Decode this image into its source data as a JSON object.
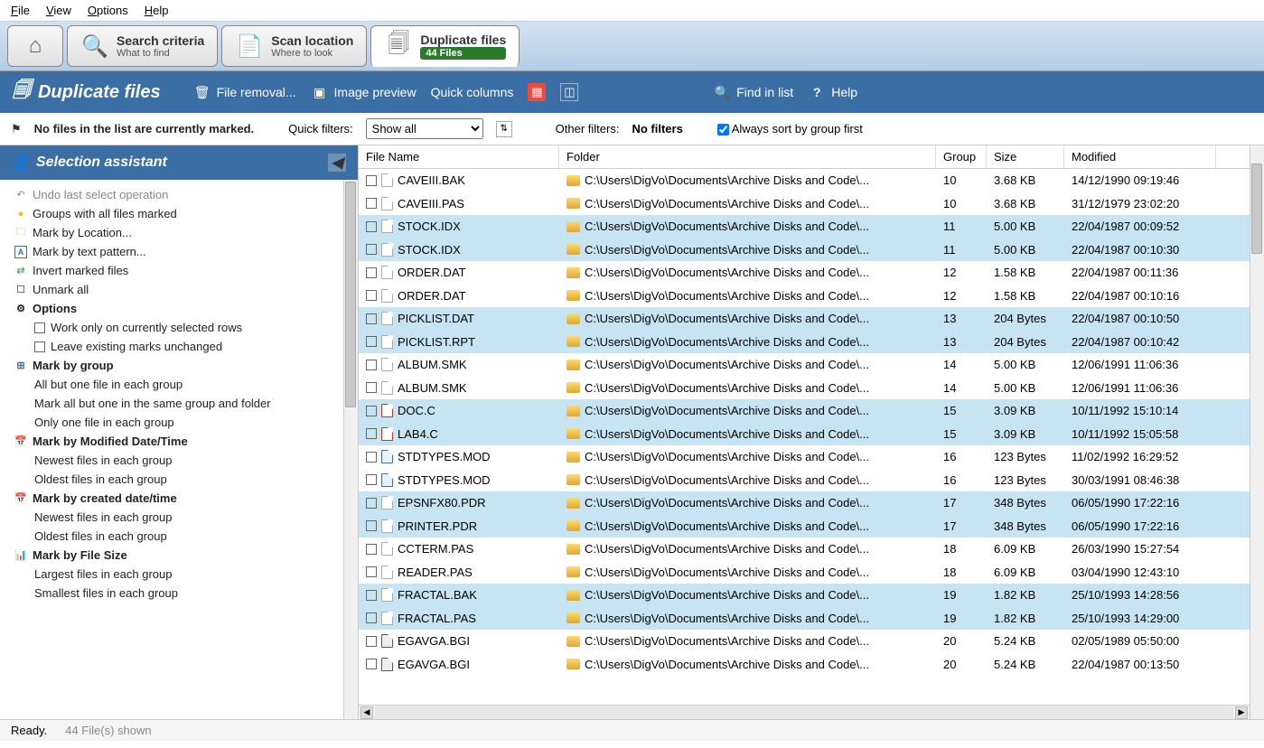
{
  "menu": {
    "file": "File",
    "view": "View",
    "options": "Options",
    "help": "Help"
  },
  "tabs": {
    "home": {
      "icon": "home"
    },
    "criteria": {
      "title": "Search criteria",
      "sub": "What to find"
    },
    "location": {
      "title": "Scan location",
      "sub": "Where to look"
    },
    "duplicates": {
      "title": "Duplicate files",
      "sub": "44 Files"
    }
  },
  "actionbar": {
    "title": "Duplicate files",
    "removal": "File removal...",
    "preview": "Image preview",
    "quickcols": "Quick columns",
    "findlist": "Find in list",
    "help": "Help"
  },
  "filterbar": {
    "marked_info": "No files in the list are currently marked.",
    "quick_label": "Quick filters:",
    "quick_value": "Show all",
    "other_label": "Other filters:",
    "other_value": "No filters",
    "always_sort": "Always sort by group first"
  },
  "sidebar": {
    "title": "Selection assistant",
    "undo": "Undo last select operation",
    "groups_marked": "Groups with all files marked",
    "mark_location": "Mark by Location...",
    "mark_text": "Mark by text pattern...",
    "invert": "Invert marked files",
    "unmark": "Unmark all",
    "options": "Options",
    "opt_work": "Work only on currently selected rows",
    "opt_leave": "Leave existing marks unchanged",
    "mark_group": "Mark by group",
    "mg_allbutone": "All but one file in each group",
    "mg_samegroup": "Mark all but one in the same group and folder",
    "mg_onlyone": "Only one file in each group",
    "mark_modified": "Mark by Modified Date/Time",
    "mm_newest": "Newest files in each group",
    "mm_oldest": "Oldest files in each group",
    "mark_created": "Mark by created date/time",
    "mc_newest": "Newest files in each group",
    "mc_oldest": "Oldest files in each group",
    "mark_size": "Mark by File Size",
    "ms_largest": "Largest files in each group",
    "ms_smallest": "Smallest files in each group"
  },
  "columns": {
    "name": "File Name",
    "folder": "Folder",
    "group": "Group",
    "size": "Size",
    "mod": "Modified"
  },
  "folder_path": "C:\\Users\\DigVo\\Documents\\Archive Disks and Code\\...",
  "files": [
    {
      "name": "CAVEIII.BAK",
      "group": "10",
      "size": "3.68 KB",
      "mod": "14/12/1990 09:19:46",
      "icon": "file",
      "alt": false
    },
    {
      "name": "CAVEIII.PAS",
      "group": "10",
      "size": "3.68 KB",
      "mod": "31/12/1979 23:02:20",
      "icon": "file",
      "alt": false
    },
    {
      "name": "STOCK.IDX",
      "group": "11",
      "size": "5.00 KB",
      "mod": "22/04/1987 00:09:52",
      "icon": "file",
      "alt": true
    },
    {
      "name": "STOCK.IDX",
      "group": "11",
      "size": "5.00 KB",
      "mod": "22/04/1987 00:10:30",
      "icon": "file",
      "alt": true
    },
    {
      "name": "ORDER.DAT",
      "group": "12",
      "size": "1.58 KB",
      "mod": "22/04/1987 00:11:36",
      "icon": "file",
      "alt": false
    },
    {
      "name": "ORDER.DAT",
      "group": "12",
      "size": "1.58 KB",
      "mod": "22/04/1987 00:10:16",
      "icon": "file",
      "alt": false
    },
    {
      "name": "PICKLIST.DAT",
      "group": "13",
      "size": "204 Bytes",
      "mod": "22/04/1987 00:10:50",
      "icon": "file",
      "alt": true
    },
    {
      "name": "PICKLIST.RPT",
      "group": "13",
      "size": "204 Bytes",
      "mod": "22/04/1987 00:10:42",
      "icon": "file",
      "alt": true
    },
    {
      "name": "ALBUM.SMK",
      "group": "14",
      "size": "5.00 KB",
      "mod": "12/06/1991 11:06:36",
      "icon": "file",
      "alt": false
    },
    {
      "name": "ALBUM.SMK",
      "group": "14",
      "size": "5.00 KB",
      "mod": "12/06/1991 11:06:36",
      "icon": "file",
      "alt": false
    },
    {
      "name": "DOC.C",
      "group": "15",
      "size": "3.09 KB",
      "mod": "10/11/1992 15:10:14",
      "icon": "c",
      "alt": true
    },
    {
      "name": "LAB4.C",
      "group": "15",
      "size": "3.09 KB",
      "mod": "10/11/1992 15:05:58",
      "icon": "c",
      "alt": true
    },
    {
      "name": "STDTYPES.MOD",
      "group": "16",
      "size": "123 Bytes",
      "mod": "11/02/1992 16:29:52",
      "icon": "mod",
      "alt": false
    },
    {
      "name": "STDTYPES.MOD",
      "group": "16",
      "size": "123 Bytes",
      "mod": "30/03/1991 08:46:38",
      "icon": "mod",
      "alt": false
    },
    {
      "name": "EPSNFX80.PDR",
      "group": "17",
      "size": "348 Bytes",
      "mod": "06/05/1990 17:22:16",
      "icon": "file",
      "alt": true
    },
    {
      "name": "PRINTER.PDR",
      "group": "17",
      "size": "348 Bytes",
      "mod": "06/05/1990 17:22:16",
      "icon": "file",
      "alt": true
    },
    {
      "name": "CCTERM.PAS",
      "group": "18",
      "size": "6.09 KB",
      "mod": "26/03/1990 15:27:54",
      "icon": "file",
      "alt": false
    },
    {
      "name": "READER.PAS",
      "group": "18",
      "size": "6.09 KB",
      "mod": "03/04/1990 12:43:10",
      "icon": "file",
      "alt": false
    },
    {
      "name": "FRACTAL.BAK",
      "group": "19",
      "size": "1.82 KB",
      "mod": "25/10/1993 14:28:56",
      "icon": "file",
      "alt": true
    },
    {
      "name": "FRACTAL.PAS",
      "group": "19",
      "size": "1.82 KB",
      "mod": "25/10/1993 14:29:00",
      "icon": "file",
      "alt": true
    },
    {
      "name": "EGAVGA.BGI",
      "group": "20",
      "size": "5.24 KB",
      "mod": "02/05/1989 05:50:00",
      "icon": "bgi",
      "alt": false
    },
    {
      "name": "EGAVGA.BGI",
      "group": "20",
      "size": "5.24 KB",
      "mod": "22/04/1987 00:13:50",
      "icon": "bgi",
      "alt": false
    }
  ],
  "status": {
    "ready": "Ready.",
    "shown": "44 File(s) shown"
  }
}
